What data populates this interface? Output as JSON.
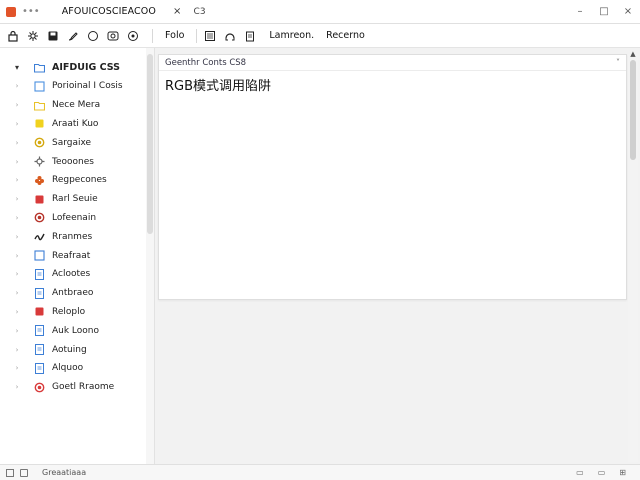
{
  "titlebar": {
    "tab_title": "AFOUICOSCIEACOO",
    "tab_close": "×",
    "tab_extra": "C3",
    "window_controls": [
      "–",
      "□",
      "×"
    ]
  },
  "toolbar": {
    "text_items": [
      "Folo",
      "Lamreon.",
      "Recerno"
    ]
  },
  "sidebar": {
    "items": [
      {
        "label": "AIFDUIG CSS",
        "icon": "folder-icon",
        "color": "#3d7fd6",
        "root": true
      },
      {
        "label": "Porioinal I Cosis",
        "icon": "file-icon",
        "color": "#4a8fe0"
      },
      {
        "label": "Nece Mera",
        "icon": "folder-icon",
        "color": "#e8c229"
      },
      {
        "label": "Araati Kuo",
        "icon": "square-icon",
        "color": "#f0d21e"
      },
      {
        "label": "Sargaixe",
        "icon": "circle-icon",
        "color": "#d4a80d"
      },
      {
        "label": "Teooones",
        "icon": "gear-icon",
        "color": "#666666"
      },
      {
        "label": "Regpecones",
        "icon": "flower-icon",
        "color": "#d95b1f"
      },
      {
        "label": "Rarl Seuie",
        "icon": "square-icon",
        "color": "#d83a3a"
      },
      {
        "label": "Lofeenain",
        "icon": "circle-icon",
        "color": "#b6332a"
      },
      {
        "label": "Rranmes",
        "icon": "scribble-icon",
        "color": "#222222"
      },
      {
        "label": "Reafraat",
        "icon": "file-icon",
        "color": "#3d7fd6"
      },
      {
        "label": "Aclootes",
        "icon": "doc-icon",
        "color": "#3d7fd6"
      },
      {
        "label": "Antbraeo",
        "icon": "doc-icon",
        "color": "#3d7fd6"
      },
      {
        "label": "Reloplo",
        "icon": "square-icon",
        "color": "#d83a3a"
      },
      {
        "label": "Auk Loono",
        "icon": "doc-icon",
        "color": "#3d7fd6"
      },
      {
        "label": "Aotuing",
        "icon": "doc-icon",
        "color": "#3d7fd6"
      },
      {
        "label": "Alquoo",
        "icon": "doc-icon",
        "color": "#3d7fd6"
      },
      {
        "label": "Goetl Rraome",
        "icon": "circle-icon",
        "color": "#d83a3a"
      }
    ]
  },
  "editor": {
    "header": "Geenthr Conts CS8",
    "content": "RGB模式调用陷阱"
  },
  "statusbar": {
    "text": "Greaatiaaa"
  },
  "colors": {
    "accent": "#e2542a"
  }
}
